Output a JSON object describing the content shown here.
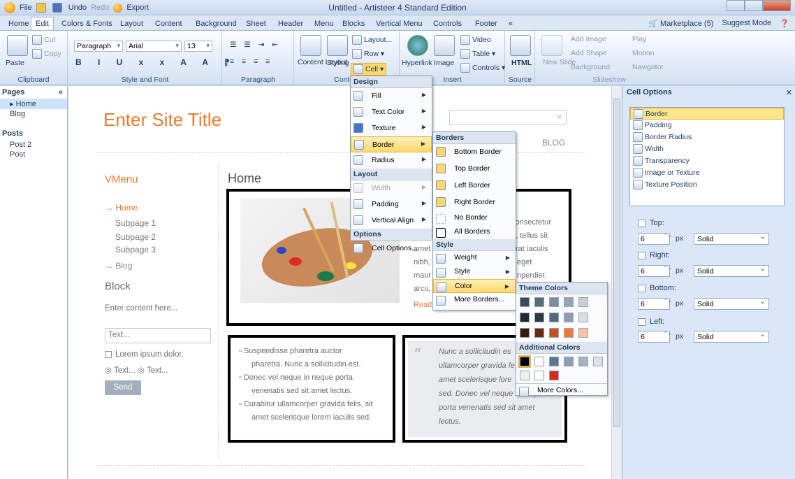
{
  "window": {
    "title": "Untitled - Artisteer 4 Standard Edition",
    "quick_access": [
      "File",
      "Undo",
      "Redo",
      "Export"
    ]
  },
  "tabs": [
    "Home",
    "Edit",
    "Colors & Fonts",
    "Layout",
    "Content",
    "Background",
    "Sheet",
    "Header",
    "Menu",
    "Blocks",
    "Vertical Menu",
    "Controls",
    "Footer",
    "«"
  ],
  "tabs_right": {
    "marketplace": "Marketplace (5)",
    "suggest": "Suggest Mode"
  },
  "ribbon": {
    "clipboard": {
      "label": "Clipboard",
      "paste": "Paste",
      "cut": "Cut",
      "copy": "Copy"
    },
    "style_font": {
      "label": "Style and Font",
      "paragraph_style": "Paragraph",
      "font": "Arial",
      "size": "13"
    },
    "paragraph": {
      "label": "Paragraph"
    },
    "content": {
      "label": "Content",
      "layout_btn": "Content Layout",
      "styling_btn": "Styling",
      "layout": "Layout...",
      "row": "Row",
      "cell": "Cell"
    },
    "insert": {
      "label": "Insert",
      "hyperlink": "Hyperlink",
      "image": "Image",
      "video": "Video",
      "table": "Table",
      "controls": "Controls"
    },
    "source": {
      "label": "Source",
      "html": "HTML"
    },
    "slideshow": {
      "label": "Slideshow",
      "new_slide": "New Slide",
      "add_image": "Add Image",
      "add_shape": "Add Shape",
      "background": "Background",
      "play": "Play",
      "motion": "Motion",
      "navigator": "Navigator"
    }
  },
  "pages_pane": {
    "header": "Pages",
    "pages": [
      "Home",
      "Blog"
    ],
    "posts_header": "Posts",
    "posts": [
      "Post 2",
      "Post"
    ]
  },
  "canvas": {
    "site_title": "Enter Site Title",
    "nav_blog": "BLOG",
    "vmenu_title": "VMenu",
    "vmenu": [
      "Home",
      "Subpage 1",
      "Subpage 2",
      "Subpage 3",
      "Blog"
    ],
    "block_title": "Block",
    "block_content": "Enter content here...",
    "text_input": "Text...",
    "checkbox_label": "Lorem ipsum dolor.",
    "radio1": "Text...",
    "radio2": "Text...",
    "send": "Send",
    "home_title": "Home",
    "article_lines": [
      "consectetur",
      "a, tellus sit",
      "amet",
      "rat iaculis",
      "nibh,",
      "eget",
      "maur",
      "nperdiet",
      "arcu,"
    ],
    "read_more": "Read more",
    "list_items": [
      "Suspendisse pharetra auctor",
      "pharetra. Nunc a sollicitudin est.",
      "Donec vel neque in neque porta",
      "venenatis sed sit amet lectus.",
      "Curabitur ullamcorper gravida felis, sit",
      "amet scelerisque lorem iaculis sed."
    ],
    "quote_lines": [
      "Nunc a sollicitudin es",
      "ullamcorper gravida fe",
      "amet scelerisque lore",
      "sed. Donec vel neque in neque",
      "porta venenatis sed sit amet",
      "lectus."
    ]
  },
  "cell_menu": {
    "design_header": "Design",
    "fill": "Fill",
    "text_color": "Text Color",
    "texture": "Texture",
    "border": "Border",
    "radius": "Radius",
    "layout_header": "Layout",
    "width": "Width",
    "padding": "Padding",
    "valign": "Vertical Align",
    "options_header": "Options",
    "cell_options": "Cell Options..."
  },
  "borders_menu": {
    "header": "Borders",
    "bottom": "Bottom Border",
    "top": "Top Border",
    "left": "Left Border",
    "right": "Right Border",
    "no_border": "No Border",
    "all_borders": "All Borders",
    "style_header": "Style",
    "weight": "Weight",
    "style": "Style",
    "color": "Color",
    "more": "More Borders..."
  },
  "color_menu": {
    "theme_header": "Theme Colors",
    "theme_rows": [
      [
        "#3e4a58",
        "#5b6b7e",
        "#7d8c9f",
        "#96a6b8",
        "#c6cfd9"
      ],
      [
        "#1f2730",
        "#2d3843",
        "#56687b",
        "#8d9cae",
        "#d9dee5"
      ],
      [
        "#3a1b0b",
        "#6e2b0b",
        "#c8511a",
        "#ee7b3c",
        "#f6c4a3"
      ]
    ],
    "additional_header": "Additional Colors",
    "additional": [
      "#000000",
      "#ffffff",
      "#5b7694",
      "#8c9fb6",
      "#a5b3c4",
      "#dde2e8",
      "#f1f1f1",
      "#ffffff",
      "#d52b1e"
    ],
    "more": "More Colors..."
  },
  "right_panel": {
    "header": "Cell Options",
    "options": [
      "Border",
      "Padding",
      "Border Radius",
      "Width",
      "Transparency",
      "Image or Texture",
      "Texture Position"
    ],
    "sides": [
      {
        "label": "Top:",
        "value": "6",
        "unit": "px",
        "style": "Solid"
      },
      {
        "label": "Right:",
        "value": "6",
        "unit": "px",
        "style": "Solid"
      },
      {
        "label": "Bottom:",
        "value": "6",
        "unit": "px",
        "style": "Solid"
      },
      {
        "label": "Left:",
        "value": "6",
        "unit": "px",
        "style": "Solid"
      }
    ]
  },
  "colors": {
    "accent": "#f07a2c",
    "ribbon": "#dce7f5",
    "highlight": "#fbd86a"
  }
}
